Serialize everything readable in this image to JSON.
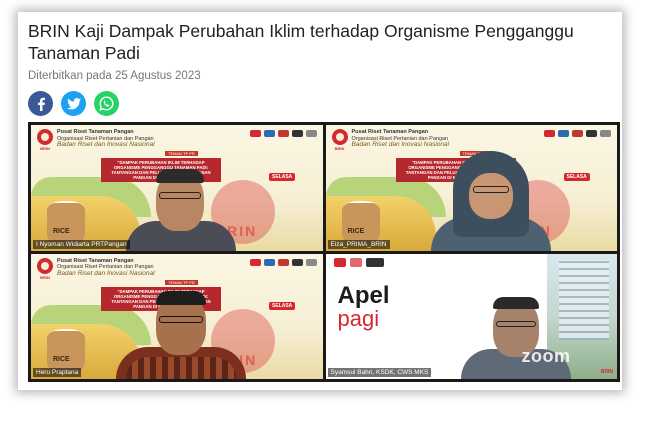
{
  "article": {
    "title": "BRIN Kaji Dampak Perubahan Iklim terhadap Organisme Pengganggu Tanaman Padi",
    "published": "Diterbitkan pada 25 Agustus 2023"
  },
  "share": [
    {
      "icon": "facebook-icon",
      "color": "#3b5998"
    },
    {
      "icon": "twitter-icon",
      "color": "#1da1f2"
    },
    {
      "icon": "whatsapp-icon",
      "color": "#25d366"
    }
  ],
  "slide": {
    "org_line1": "Pusat Riset Tanaman Pangan",
    "org_line2": "Organisasi Riset Pertanian dan Pangan",
    "org_line3": "Badan Riset dan Inovasi Nasional",
    "brin_label": "BRIN",
    "topic_tag": "TEMAN TP PR",
    "topic": "\"DAMPAK PERUBAHAN IKLIM TERHADAP ORGANISME PENGGANGGU TANAMAN PADI: TANTANGAN DAN PELUANG BAGI KETAHANAN PANGAN DI MASA DEPAN\"",
    "date": "SELASA",
    "rice_label": "RICE"
  },
  "participants": [
    {
      "name": "I Nyoman Widiarta PRTPangan"
    },
    {
      "name": "Eiza_PRIMA_BRIN"
    },
    {
      "name": "Heru Praptana"
    },
    {
      "name": "Syamsul Bahri, KSDK, CWS MKS"
    }
  ],
  "apel": {
    "line1": "Apel",
    "line2": "pagi",
    "zoom": "zoom",
    "corner": "BRIN"
  },
  "colors": {
    "brin_red": "#d5282f",
    "active_speaker": "#4fd05a"
  }
}
